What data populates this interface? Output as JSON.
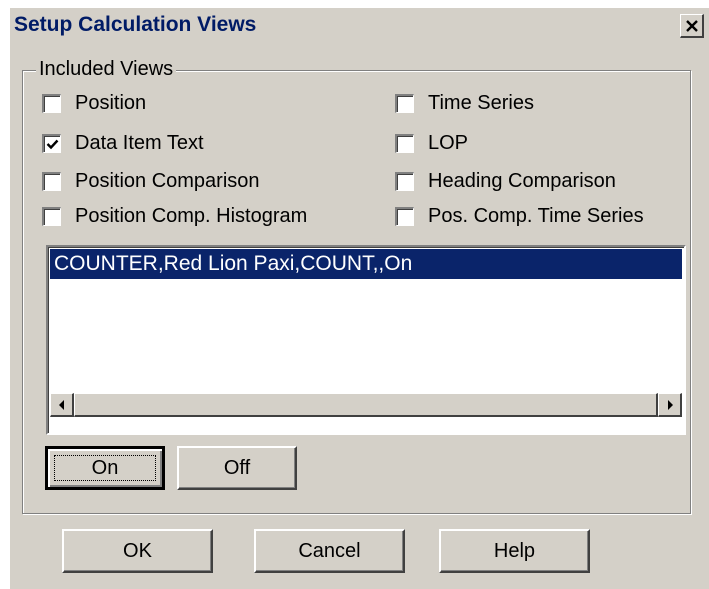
{
  "window": {
    "title": "Setup Calculation Views",
    "close_icon": "close-icon"
  },
  "included_views": {
    "group_label": "Included Views",
    "options": [
      {
        "label": "Position",
        "checked": false
      },
      {
        "label": "Data Item Text",
        "checked": true
      },
      {
        "label": "Position Comparison",
        "checked": false
      },
      {
        "label": "Position Comp. Histogram",
        "checked": false
      },
      {
        "label": "Time Series",
        "checked": false
      },
      {
        "label": "LOP",
        "checked": false
      },
      {
        "label": "Heading Comparison",
        "checked": false
      },
      {
        "label": "Pos. Comp. Time Series",
        "checked": false
      }
    ]
  },
  "list": {
    "items": [
      "COUNTER,Red Lion Paxi,COUNT,,On"
    ],
    "selected_index": 0
  },
  "toggle_buttons": {
    "on_label": "On",
    "off_label": "Off"
  },
  "footer_buttons": {
    "ok_label": "OK",
    "cancel_label": "Cancel",
    "help_label": "Help"
  },
  "colors": {
    "face": "#d4d0c8",
    "selection": "#0a246a",
    "title_text": "#001b66"
  }
}
